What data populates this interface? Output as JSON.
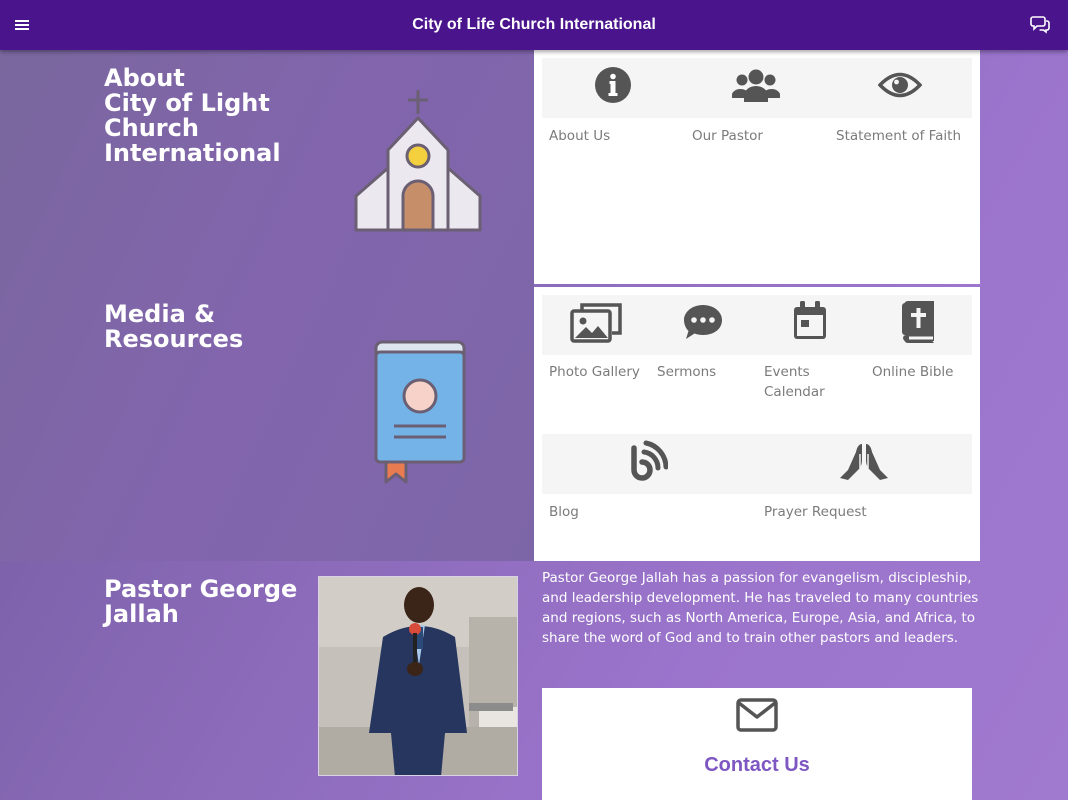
{
  "appbar": {
    "title": "City of Life Church International",
    "menu_icon": "hamburger-menu-icon",
    "chat_icon": "chat-bubbles-icon"
  },
  "about": {
    "title": "About\nCity of Light\nChurch\nInternational",
    "illustration": "church-building",
    "tiles": [
      {
        "label": "About Us",
        "icon": "info-circle-icon"
      },
      {
        "label": "Our Pastor",
        "icon": "users-group-icon"
      },
      {
        "label": "Statement of Faith",
        "icon": "eye-icon"
      }
    ]
  },
  "media": {
    "title": "Media &\nResources",
    "illustration": "bible-book",
    "tiles": [
      {
        "label": "Photo Gallery",
        "icon": "photo-gallery-icon"
      },
      {
        "label": "Sermons",
        "icon": "speech-bubble-icon"
      },
      {
        "label": "Events Calendar",
        "icon": "calendar-icon"
      },
      {
        "label": "Online Bible",
        "icon": "bible-icon"
      },
      {
        "label": "Blog",
        "icon": "blog-feed-icon"
      },
      {
        "label": "Prayer Request",
        "icon": "praying-hands-icon"
      }
    ]
  },
  "pastor": {
    "title": "Pastor George\nJallah",
    "bio": "Pastor George Jallah has a passion for evangelism, discipleship, and leadership development. He has traveled to many countries and regions, such as North America, Europe, Asia, and Africa, to share the word of God and to train other pastors and leaders."
  },
  "contact": {
    "label": "Contact Us",
    "icon": "envelope-icon"
  },
  "colors": {
    "appbar": "#4a148c",
    "accent": "#7e57c2",
    "icon_gray": "#555555",
    "label_gray": "#7b7b7b"
  }
}
